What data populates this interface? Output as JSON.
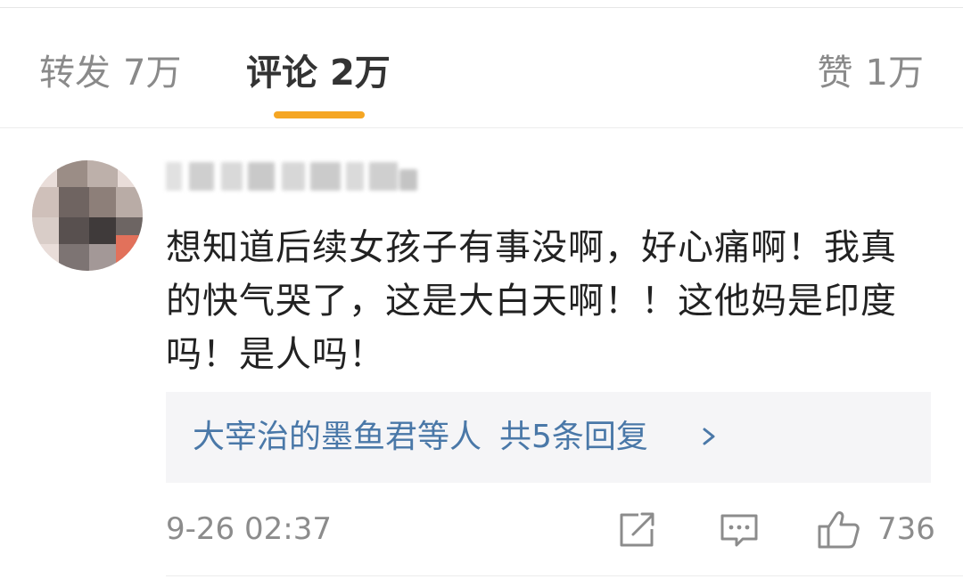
{
  "tabs": [
    {
      "label": "转发",
      "count": "7万"
    },
    {
      "label": "评论",
      "count": "2万"
    },
    {
      "label": "赞",
      "count": "1万"
    }
  ],
  "active_tab_color": "#f5a623",
  "comment": {
    "text": "想知道后续女孩子有事没啊，好心痛啊！我真的快气哭了，这是大白天啊！！这他妈是印度吗！是人吗！",
    "replies": {
      "names": "大宰治的墨鱼君等人",
      "count": "共5条回复"
    },
    "timestamp": "9-26 02:37",
    "like_count": "736",
    "icons": {
      "share": "share-edit-icon",
      "comment": "comment-bubble-icon",
      "like": "thumbs-up-icon",
      "more": "chevron-right-icon"
    }
  },
  "colors": {
    "link": "#4a78a8",
    "text": "#222222",
    "muted": "#8c8c8c"
  }
}
